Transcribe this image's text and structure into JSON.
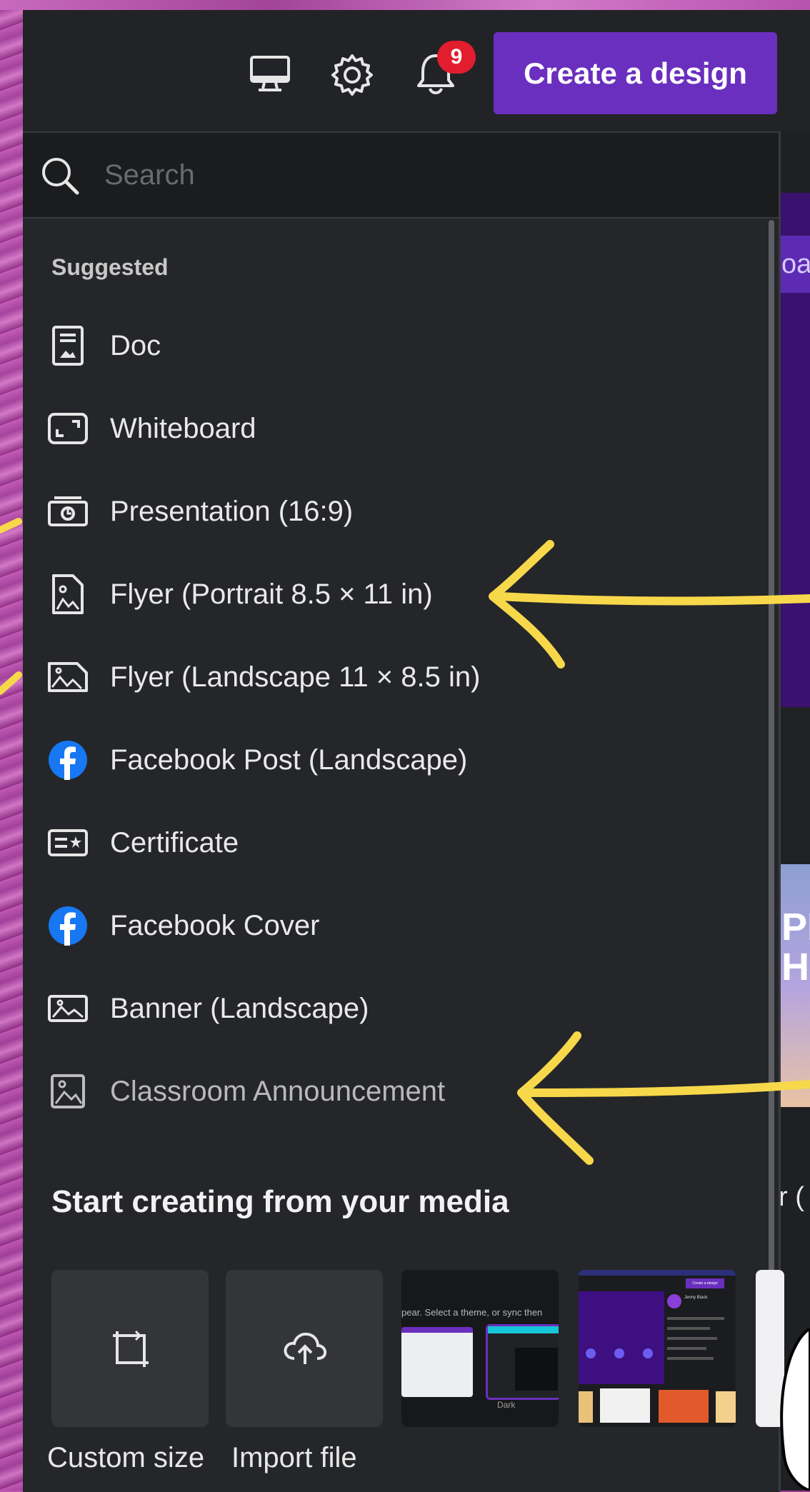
{
  "topbar": {
    "icons": [
      "desktop-icon",
      "gear-icon",
      "bell-icon"
    ],
    "notification_count": "9",
    "create_button_label": "Create a design"
  },
  "search": {
    "placeholder": "Search",
    "value": ""
  },
  "suggested": {
    "heading": "Suggested",
    "items": [
      {
        "label": "Doc",
        "icon": "doc-icon"
      },
      {
        "label": "Whiteboard",
        "icon": "whiteboard-icon"
      },
      {
        "label": "Presentation (16:9)",
        "icon": "presentation-icon"
      },
      {
        "label": "Flyer (Portrait 8.5 × 11 in)",
        "icon": "flyer-portrait-icon"
      },
      {
        "label": "Flyer (Landscape 11 × 8.5 in)",
        "icon": "flyer-landscape-icon"
      },
      {
        "label": "Facebook Post (Landscape)",
        "icon": "facebook-icon"
      },
      {
        "label": "Certificate",
        "icon": "certificate-icon"
      },
      {
        "label": "Facebook Cover",
        "icon": "facebook-icon"
      },
      {
        "label": "Banner (Landscape)",
        "icon": "image-icon"
      },
      {
        "label": "Classroom Announcement",
        "icon": "image-icon"
      }
    ]
  },
  "media": {
    "heading": "Start creating from your media",
    "tiles": [
      {
        "label": "Custom size",
        "icon": "custom-size-icon"
      },
      {
        "label": "Import file",
        "icon": "upload-cloud-icon"
      }
    ],
    "thumbnails": [
      {
        "caption": "pear. Select a theme, or sync then",
        "sublabel": "Dark"
      },
      {
        "caption": "Create a design",
        "sublabel": "Jenny Black"
      }
    ]
  },
  "background_peek": {
    "bar_text": "oa",
    "card_text": "PR\nHE",
    "lower_text": "r ("
  },
  "colors": {
    "accent": "#6a2fbe",
    "badge": "#e11d2e",
    "panel": "#252629",
    "arrow": "#f7d84a",
    "facebook": "#1877f2"
  }
}
